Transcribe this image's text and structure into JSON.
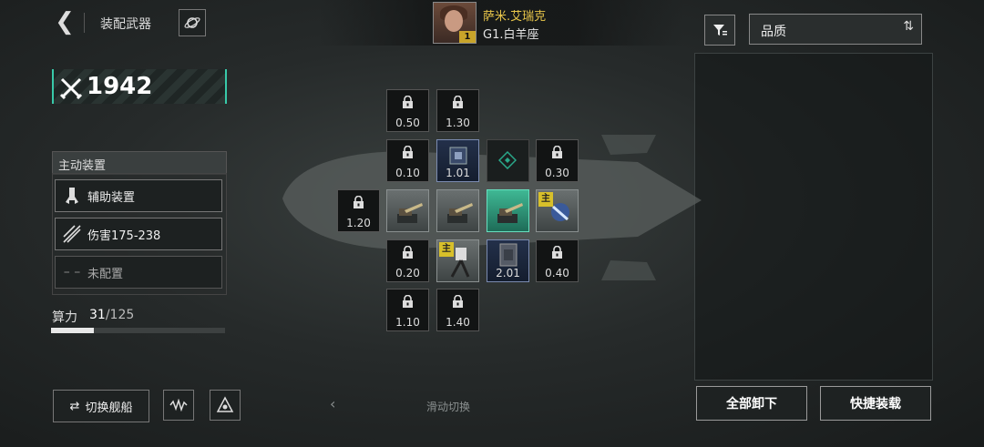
{
  "header": {
    "title": "装配武器"
  },
  "pilot": {
    "name": "萨米.艾瑞克",
    "level": "1",
    "subtitle": "G1.白羊座"
  },
  "sort": {
    "selected": "品质"
  },
  "power": {
    "value": "1942"
  },
  "active_devices": {
    "title": "主动装置",
    "items": [
      {
        "label": "辅助装置",
        "icon": "support-device-icon"
      },
      {
        "label": "伤害175-238",
        "icon": "damage-icon"
      },
      {
        "label": "未配置",
        "icon": "empty-dash-icon"
      }
    ]
  },
  "compute": {
    "label": "算力",
    "used": "31",
    "total": "/125",
    "fraction": 0.248
  },
  "bottom": {
    "switch_ship": "切换舰船",
    "swipe_hint": "滑动切换",
    "unequip_all": "全部卸下",
    "quick_equip": "快捷装载"
  },
  "slots": {
    "s050": "0.50",
    "s130": "1.30",
    "s010": "0.10",
    "s101": "1.01",
    "s030": "0.30",
    "s120": "1.20",
    "s020": "0.20",
    "s201": "2.01",
    "s040": "0.40",
    "s110": "1.10",
    "s140": "1.40",
    "main_tag": "主"
  },
  "colors": {
    "accent": "#38c9a9",
    "gold": "#d8c02a",
    "pilot_name": "#e8c64a"
  }
}
